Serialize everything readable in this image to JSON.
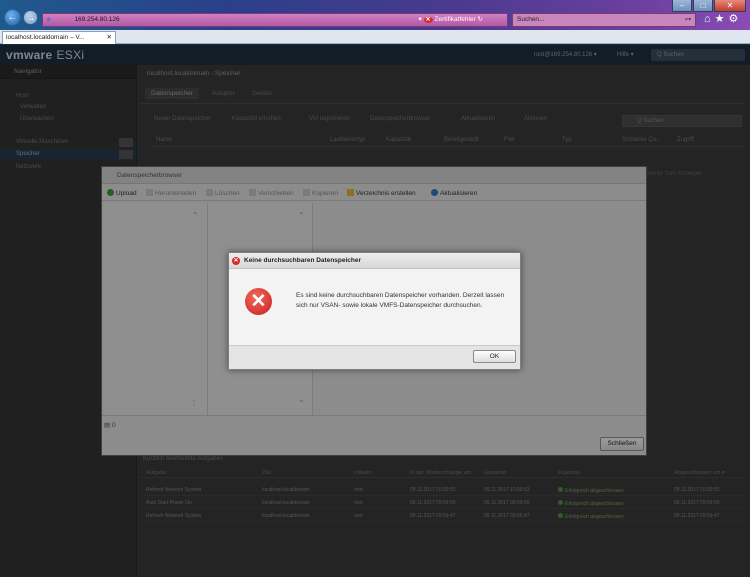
{
  "browser": {
    "address": "169.254.80.126",
    "cert_error": "Zertifikatfehler",
    "search_placeholder": "Suchen...",
    "tab_title": "localhost.localdomain – V..."
  },
  "esxi": {
    "logo_vm": "vmware",
    "logo_product": "ESXi",
    "host_info": "root@169.254.80.126 ▾",
    "help": "Hilfe ▾",
    "top_search": "Q Suchen"
  },
  "navigator": {
    "title": "Navigator",
    "items": [
      {
        "label": "Host"
      },
      {
        "label": "Verwalten"
      },
      {
        "label": "Überwachen"
      },
      {
        "label": "Virtuelle Maschinen"
      },
      {
        "label": "Speicher"
      },
      {
        "label": "Netzwerk"
      }
    ]
  },
  "main": {
    "title": "localhost.localdomain - Speicher",
    "tabs": [
      "Datenspeicher",
      "Adapter",
      "Geräte"
    ],
    "toolbar": [
      "Neuer Datenspeicher",
      "Kapazität erhöhen",
      "VM registrieren",
      "Datenspeicherbrowser",
      "Aktualisieren",
      "Aktionen"
    ],
    "search_placeholder": "Q Suchen",
    "columns": [
      "Name",
      "Laufwerkstyp",
      "Kapazität",
      "Bereitgestellt",
      "Frei",
      "Typ",
      "Schlanke Co...",
      "Zugriff"
    ],
    "right_hint": "r Elemente zum Anzeigen"
  },
  "ds_browser": {
    "title": "Datenspeicherbrowser",
    "toolbar": [
      "Upload",
      "Herunterladen",
      "Löschen",
      "Verschieben",
      "Kopieren",
      "Verzeichnis erstellen",
      "Aktualisieren"
    ],
    "status": "0",
    "close_label": "Schließen"
  },
  "error_dialog": {
    "title": "Keine durchsuchbaren Datenspeicher",
    "message": "Es sind keine durchsuchbaren Datenspeicher vorhanden. Derzeit lassen sich nur VSAN- sowie lokale VMFS-Datenspeicher durchsuchen.",
    "ok_label": "OK"
  },
  "tasks": {
    "title": "Kürzlich bearbeitete Aufgaben",
    "columns": [
      "Aufgabe",
      "Ziel",
      "Initiator",
      "In der Warteschlange um",
      "Gestartet",
      "Ergebnis",
      "Abgeschlossen um ▾"
    ],
    "rows": [
      {
        "task": "Refresh Network System",
        "target": "localhost.localdomain",
        "initiator": "root",
        "queued": "09.11.2017 10:09:53",
        "started": "09.11.2017 10:09:53",
        "result": "Erfolgreich abgeschlossen",
        "completed": "09.11.2017 10:09:53"
      },
      {
        "task": "Auto Start Power On",
        "target": "localhost.localdomain",
        "initiator": "root",
        "queued": "09.11.2017 09:59:50",
        "started": "09.11.2017 09:59:50",
        "result": "Erfolgreich abgeschlossen",
        "completed": "09.11.2017 09:59:50"
      },
      {
        "task": "Refresh Network System",
        "target": "localhost.localdomain",
        "initiator": "root",
        "queued": "09.11.2017 09:59:47",
        "started": "09.11.2017 09:59:47",
        "result": "Erfolgreich abgeschlossen",
        "completed": "09.11.2017 09:59:47"
      }
    ]
  }
}
